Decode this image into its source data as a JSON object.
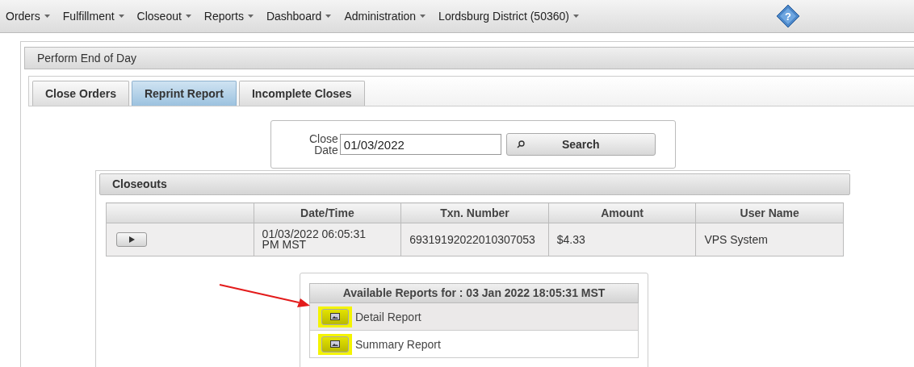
{
  "menu": [
    {
      "label": "Orders"
    },
    {
      "label": "Fulfillment"
    },
    {
      "label": "Closeout"
    },
    {
      "label": "Reports"
    },
    {
      "label": "Dashboard"
    },
    {
      "label": "Administration"
    },
    {
      "label": "Lordsburg District (50360)"
    }
  ],
  "help": {
    "label": "?"
  },
  "panel": {
    "title": "Perform End of Day"
  },
  "tabs": [
    {
      "label": "Close Orders",
      "selected": false
    },
    {
      "label": "Reprint Report",
      "selected": true
    },
    {
      "label": "Incomplete Closes",
      "selected": false
    }
  ],
  "search": {
    "label_line1": "Close",
    "label_line2": "Date",
    "value": "01/03/2022",
    "button": "Search"
  },
  "closeouts": {
    "title": "Closeouts",
    "columns": [
      "Date/Time",
      "Txn. Number",
      "Amount",
      "User Name"
    ],
    "rows": [
      {
        "datetime": "01/03/2022 06:05:31 PM MST",
        "txn": "69319192022010307053",
        "amount": "$4.33",
        "user": "VPS System"
      }
    ]
  },
  "reports": {
    "title": "Available Reports for : 03 Jan 2022 18:05:31 MST",
    "items": [
      {
        "label": "Detail Report",
        "selected": true,
        "highlighted": true
      },
      {
        "label": "Summary Report",
        "selected": false,
        "highlighted": true
      }
    ]
  }
}
